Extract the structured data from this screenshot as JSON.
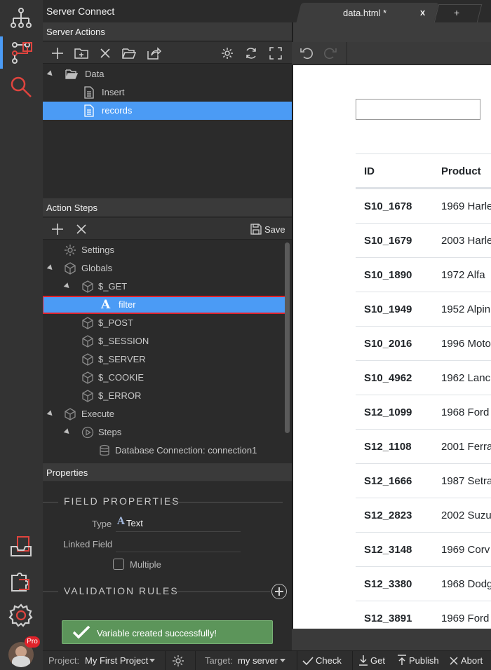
{
  "app": {
    "panel_title": "Server Connect"
  },
  "tabs": {
    "active": "data.html *",
    "close": "x",
    "add": "+"
  },
  "server_actions": {
    "title": "Server Actions",
    "tree": [
      {
        "label": "Data",
        "type": "folder"
      },
      {
        "label": "Insert",
        "type": "file"
      },
      {
        "label": "records",
        "type": "file",
        "selected": true
      }
    ]
  },
  "action_steps": {
    "title": "Action Steps",
    "save_label": "Save",
    "tree": [
      {
        "label": "Settings"
      },
      {
        "label": "Globals"
      },
      {
        "label": "$_GET"
      },
      {
        "label": "filter"
      },
      {
        "label": "$_POST"
      },
      {
        "label": "$_SESSION"
      },
      {
        "label": "$_SERVER"
      },
      {
        "label": "$_COOKIE"
      },
      {
        "label": "$_ERROR"
      },
      {
        "label": "Execute"
      },
      {
        "label": "Steps"
      },
      {
        "label": "Database Connection: connection1"
      }
    ]
  },
  "properties": {
    "title": "Properties",
    "field_properties": "FIELD PROPERTIES",
    "type_label": "Type",
    "type_value": "Text",
    "type_icon": "A",
    "linked_field_label": "Linked Field",
    "linked_field_value": "",
    "multiple_label": "Multiple",
    "multiple_checked": false,
    "validation_rules": "VALIDATION RULES"
  },
  "toast": {
    "message": "Variable created successfully!"
  },
  "statusbar": {
    "project_label": "Project:",
    "project_value": "My First Project",
    "target_label": "Target:",
    "target_value": "my server",
    "check": "Check",
    "get": "Get",
    "publish": "Publish",
    "abort": "Abort"
  },
  "user": {
    "badge": "Pro"
  },
  "table": {
    "headers": [
      "ID",
      "Product"
    ],
    "rows": [
      [
        "S10_1678",
        "1969 Harle"
      ],
      [
        "S10_1679",
        "2003 Harle"
      ],
      [
        "S10_1890",
        "1972 Alfa"
      ],
      [
        "S10_1949",
        "1952 Alpin"
      ],
      [
        "S10_2016",
        "1996 Moto"
      ],
      [
        "S10_4962",
        "1962 Lanc"
      ],
      [
        "S12_1099",
        "1968 Ford"
      ],
      [
        "S12_1108",
        "2001 Ferra"
      ],
      [
        "S12_1666",
        "1987 Setra"
      ],
      [
        "S12_2823",
        "2002 Suzu"
      ],
      [
        "S12_3148",
        "1969 Corv"
      ],
      [
        "S12_3380",
        "1968 Dodg"
      ],
      [
        "S12_3891",
        "1969 Ford"
      ]
    ]
  },
  "colors": {
    "accent": "#4b9bf5",
    "highlight_border": "#e0222a",
    "toast": "#5c955a",
    "rail_red": "#e0443e"
  }
}
